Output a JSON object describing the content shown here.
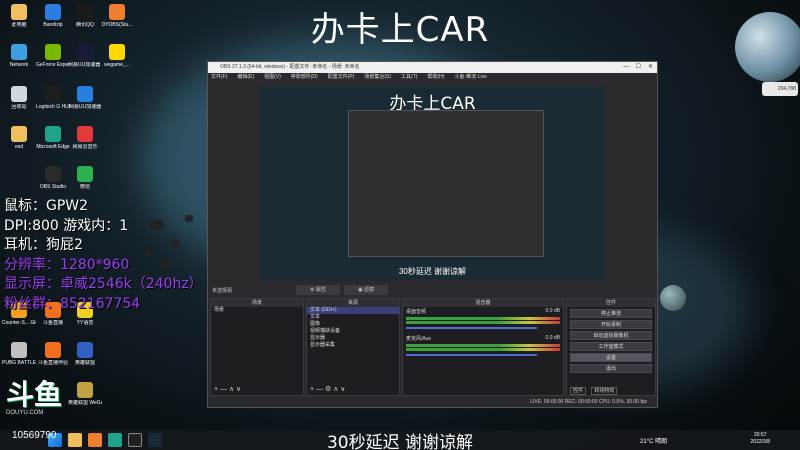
{
  "stream": {
    "title": "办卡上CAR",
    "subtitle": "30秒延迟 谢谢谅解",
    "viewer_count": "10569790",
    "overlay": [
      "鼠标：GPW2",
      "DPI:800 游戏内：1",
      "耳机：狗屁2",
      "分辨率：1280*960",
      "显示屏：卓威2546k（240hz）",
      "粉丝群：852167754"
    ],
    "overlay_colors": [
      "#ffffff",
      "#ffffff",
      "#ffffff",
      "#9a3cf0",
      "#9a3cf0",
      "#9a3cf0"
    ],
    "watermark": "DOUYU.COM",
    "badge": "294,788"
  },
  "desktop_icons": [
    {
      "label": "此电脑",
      "color": "#f0c060"
    },
    {
      "label": "Bandizip",
      "color": "#2a7de1"
    },
    {
      "label": "腾讯QQ",
      "color": "#1a1a1a"
    },
    {
      "label": "DYOBS(Stu...",
      "color": "#f08030"
    },
    {
      "label": "Network",
      "color": "#3aa0e0"
    },
    {
      "label": "GeForce Experience",
      "color": "#76b900"
    },
    {
      "label": "网易UU加速器 平台",
      "color": "#1a1a3a"
    },
    {
      "label": "wegame_...",
      "color": "#ffd700"
    },
    {
      "label": "回收站",
      "color": "#cfd8dc"
    },
    {
      "label": "Logitech G HUB",
      "color": "#1e1e1e"
    },
    {
      "label": "网易UU加速器",
      "color": "#2a7de1"
    },
    {
      "label": "esd",
      "color": "#f0c060"
    },
    {
      "label": "Microsoft Edge",
      "color": "#1fa38a"
    },
    {
      "label": "网易云音乐",
      "color": "#e03a3a"
    },
    {
      "label": "OBS Studio",
      "color": "#2a2a2a"
    },
    {
      "label": "微信",
      "color": "#2bb24c"
    },
    {
      "label": "Counter-S... Global Off...",
      "color": "#f0a020"
    },
    {
      "label": "斗鱼直播",
      "color": "#f07020"
    },
    {
      "label": "YY语音",
      "color": "#f0d020"
    },
    {
      "label": "PUBG BATTLEGR...",
      "color": "#c0c0c0"
    },
    {
      "label": "斗鱼直播伴侣",
      "color": "#f07020"
    },
    {
      "label": "英雄联盟",
      "color": "#3060c0"
    },
    {
      "label": "英雄联盟 WeGame版",
      "color": "#c0a040"
    }
  ],
  "obs": {
    "window_title": "OBS 27.1.3 (64-bit, windows) - 配置文件: 未命名 - 场景: 未命名",
    "menu": [
      "文件(F)",
      "编辑(E)",
      "视图(V)",
      "停靠部件(D)",
      "配置文件(P)",
      "场景集合(S)",
      "工具(T)",
      "帮助(H)",
      "斗鱼·推流·Live"
    ],
    "status_left": "未选择源",
    "scenes_header": "场景",
    "scenes": [
      "场景"
    ],
    "sources_header": "来源",
    "sources": [
      "文本 (GDI+)",
      "文本",
      "图像",
      "视频捕获设备",
      "显示器",
      "显示器采集"
    ],
    "mixer_header": "混音器",
    "mixer": [
      {
        "name": "桌面音频",
        "level": "0.0 dB"
      },
      {
        "name": "麦克风/Aux",
        "level": "0.0 dB"
      }
    ],
    "controls_header": "控件",
    "controls": [
      "停止推流",
      "开始录制",
      "启动虚拟摄像机",
      "工作室模式",
      "设置",
      "退出"
    ],
    "controls_tabs": [
      "控件",
      "转场特效"
    ],
    "statusbar": "LIVE: 00:00:00   REC: 00:00:00   CPU: 0.5%, 30.00 fps"
  },
  "taskbar": {
    "weather": "21°C 晴朗",
    "time": "20:57",
    "date": "2022/3/8"
  }
}
